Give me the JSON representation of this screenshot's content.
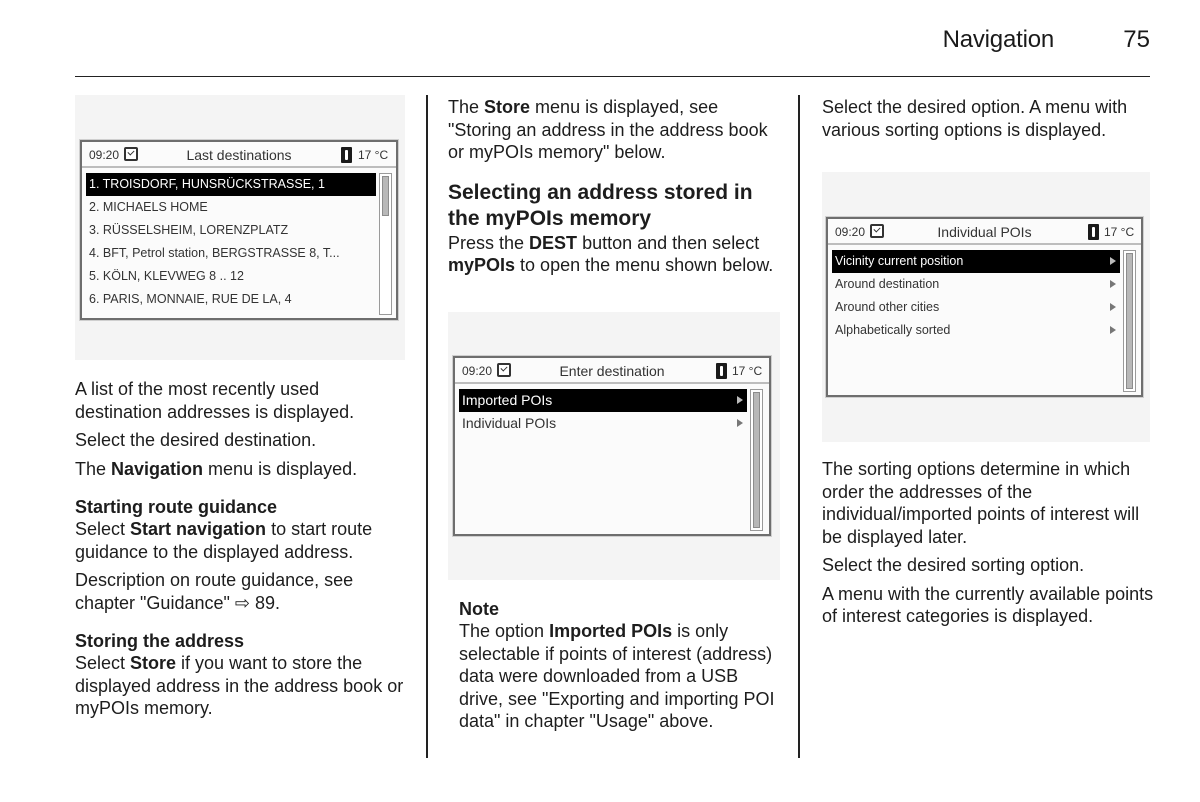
{
  "header": {
    "section_title": "Navigation",
    "page_number": "75"
  },
  "col1": {
    "screen": {
      "time": "09:20",
      "title": "Last destinations",
      "temperature": "17 °C",
      "items": [
        {
          "label": "1. TROISDORF, HUNSRÜCKSTRASSE, 1",
          "selected": true
        },
        {
          "label": "2. MICHAELS HOME",
          "selected": false
        },
        {
          "label": "3. RÜSSELSHEIM, LORENZPLATZ",
          "selected": false
        },
        {
          "label": "4. BFT, Petrol station, BERGSTRASSE 8, T...",
          "selected": false
        },
        {
          "label": "5. KÖLN, KLEVWEG 8 .. 12",
          "selected": false
        },
        {
          "label": "6. PARIS, MONNAIE, RUE DE LA, 4",
          "selected": false
        }
      ]
    },
    "para1": "A list of the most recently used destination addresses is displayed.",
    "para2": "Select the desired destination.",
    "para3_pre": "The ",
    "para3_bold": "Navigation",
    "para3_post": " menu is displayed.",
    "heading1": "Starting route guidance",
    "para4_pre": "Select ",
    "para4_bold": "Start navigation",
    "para4_post": " to start route guidance to the displayed address.",
    "para5_pre": "Description on route guidance, see chapter \"Guidance\" ",
    "para5_ref_icon": "⇨",
    "para5_post": " 89.",
    "heading2": "Storing the address",
    "para6_pre": "Select ",
    "para6_bold": "Store",
    "para6_post": " if you want to store the displayed address in the address book or myPOIs memory."
  },
  "col2": {
    "para1_pre": "The ",
    "para1_bold": "Store",
    "para1_post": " menu is displayed, see \"Storing an address in the address book or myPOIs memory\" below.",
    "heading": "Selecting an address stored in the myPOIs memory",
    "para2_pre": "Press the ",
    "para2_bold1": "DEST",
    "para2_mid": " button and then select ",
    "para2_bold2": "myPOIs",
    "para2_post": " to open the menu shown below.",
    "screen": {
      "time": "09:20",
      "title": "Enter destination",
      "temperature": "17 °C",
      "items": [
        {
          "label": "Imported POIs",
          "selected": true
        },
        {
          "label": "Individual POIs",
          "selected": false
        }
      ]
    },
    "note_heading": "Note",
    "note_pre": "The option ",
    "note_bold": "Imported POIs",
    "note_post": " is only selectable if points of interest (address) data were downloaded from a USB drive, see \"Exporting and importing POI data\" in chapter \"Usage\" above."
  },
  "col3": {
    "para1": "Select the desired option. A menu with various sorting options is displayed.",
    "screen": {
      "time": "09:20",
      "title": "Individual POIs",
      "temperature": "17 °C",
      "items": [
        {
          "label": "Vicinity current position",
          "selected": true
        },
        {
          "label": "Around destination",
          "selected": false
        },
        {
          "label": "Around other cities",
          "selected": false
        },
        {
          "label": "Alphabetically sorted",
          "selected": false
        }
      ]
    },
    "para2": "The sorting options determine in which order the addresses of the individual/imported points of interest will be displayed later.",
    "para3": "Select the desired sorting option.",
    "para4": "A menu with the currently available points of interest categories is displayed."
  }
}
